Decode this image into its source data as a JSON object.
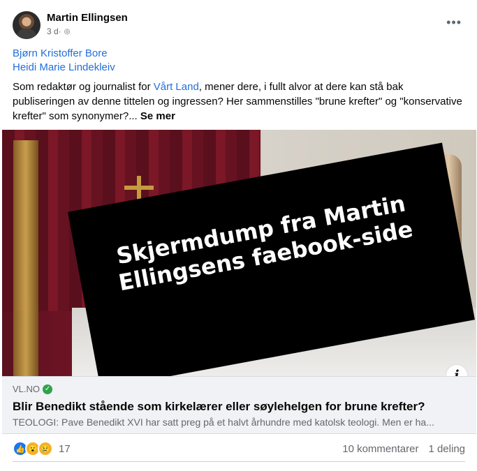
{
  "author": {
    "name": "Martin Ellingsen",
    "time": "3 d",
    "privacy_icon": "public-globe-icon"
  },
  "tags": [
    "Bjørn Kristoffer Bore",
    "Heidi Marie Lindekleiv"
  ],
  "post_text": {
    "before_link": "Som redaktør og journalist for ",
    "link": "Vårt Land",
    "after_link": ", mener dere, i fullt alvor at dere kan stå bak publiseringen av denne tittelen og ingressen? Her sammenstilles \"brune krefter\" og \"konservative krefter\" som synonymer?... ",
    "see_more": "Se mer"
  },
  "image_overlay": "Skjermdump fra Martin Ellingsens faebook-side",
  "link_preview": {
    "domain": "VL.NO",
    "title": "Blir Benedikt stående som kirkelærer eller søylehelgen for brune krefter?",
    "description": "TEOLOGI: Pave Benedikt XVI har satt preg på et halvt århundre med katolsk teologi. Men er ha..."
  },
  "engagement": {
    "reactions_count": "17",
    "comments": "10 kommentarer",
    "shares": "1 deling"
  },
  "colors": {
    "link": "#216fdb",
    "muted": "#65676b"
  }
}
